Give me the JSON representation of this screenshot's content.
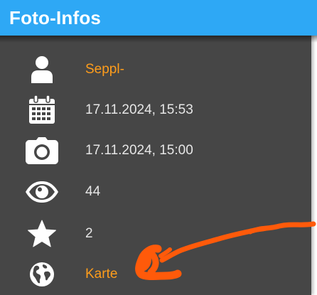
{
  "panel": {
    "title": "Foto-Infos"
  },
  "rows": [
    {
      "icon": "user-icon",
      "value": "Seppl-",
      "link": true
    },
    {
      "icon": "calendar-icon",
      "value": "17.11.2024, 15:53",
      "link": false
    },
    {
      "icon": "camera-icon",
      "value": "17.11.2024, 15:00",
      "link": false
    },
    {
      "icon": "eye-icon",
      "value": "44",
      "link": false
    },
    {
      "icon": "star-icon",
      "value": "2",
      "link": false
    },
    {
      "icon": "globe-icon",
      "value": "Karte",
      "link": true
    }
  ],
  "colors": {
    "header": "#2ea8f5",
    "panel": "#464646",
    "link": "#ff9d1b",
    "text": "#e6e6e6",
    "annotation": "#ff5a0a"
  }
}
